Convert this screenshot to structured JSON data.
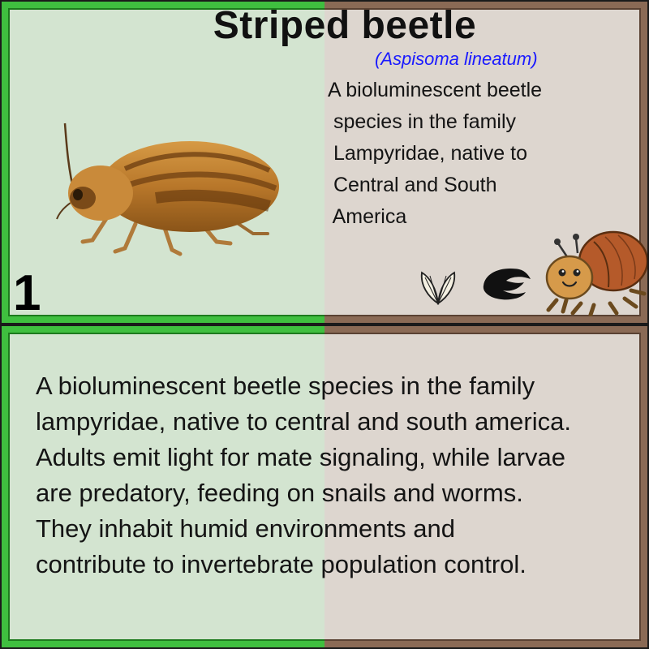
{
  "card": {
    "title": "Striped beetle",
    "scientific_name": "(Aspisoma lineatum)",
    "number": "1",
    "short_description_lines": [
      "A bioluminescent beetle",
      " species in the family",
      " Lampyridae, native to",
      " Central and South",
      " America"
    ],
    "long_description_lines": [
      "A bioluminescent beetle species in the family",
      "lampyridae, native to central and south america.",
      "Adults emit light for mate signaling, while larvae",
      "are predatory, feeding on snails and worms.",
      "They inhabit humid environments and",
      "contribute to invertebrate population control."
    ],
    "icons": [
      "wings-icon",
      "pincer-icon",
      "cartoon-beetle-icon"
    ],
    "colors": {
      "left_tint": "#d3e4d0",
      "right_tint": "#ddd6cf",
      "left_border": "#3fbf3f",
      "right_border": "#8a6a55",
      "scientific_name": "#1a1aff"
    }
  }
}
